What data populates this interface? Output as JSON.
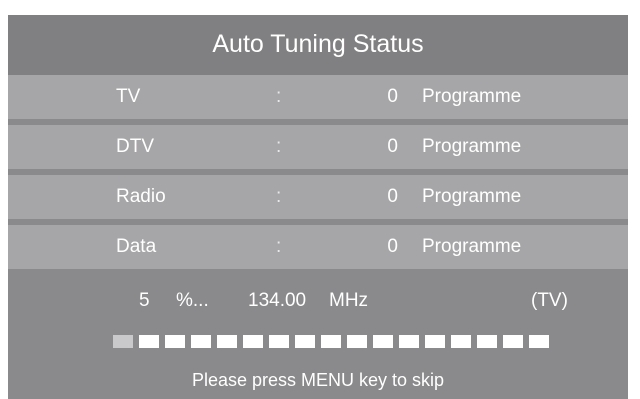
{
  "title": "Auto Tuning Status",
  "rows": [
    {
      "label": "TV",
      "separator": ":",
      "count": "0",
      "unit": "Programme"
    },
    {
      "label": "DTV",
      "separator": ":",
      "count": "0",
      "unit": "Programme"
    },
    {
      "label": "Radio",
      "separator": ":",
      "count": "0",
      "unit": "Programme"
    },
    {
      "label": "Data",
      "separator": ":",
      "count": "0",
      "unit": "Programme"
    }
  ],
  "status": {
    "percent": "5",
    "percent_unit": "%...",
    "frequency": "134.00",
    "frequency_unit": "MHz",
    "band": "(TV)"
  },
  "progress": {
    "total_segments": 17,
    "done_segments": 1,
    "fraction": 0.05
  },
  "footer": "Please press MENU key to skip",
  "colors": {
    "panel": "#8a898b",
    "title_bar": "#807f81",
    "row": "#a6a5a7",
    "text": "#ffffff"
  }
}
